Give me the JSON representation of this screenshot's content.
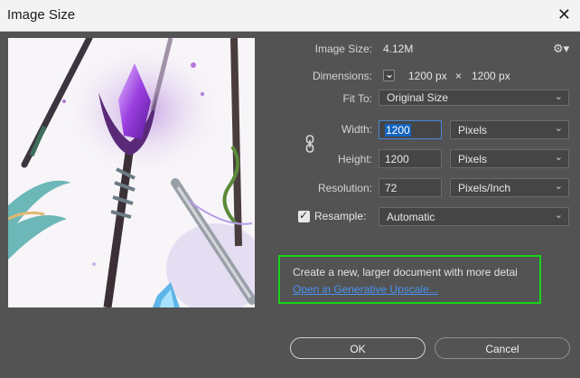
{
  "window": {
    "title": "Image Size",
    "close_icon": "close-icon"
  },
  "info": {
    "image_size_label": "Image Size:",
    "image_size_value": "4.12M",
    "dimensions_label": "Dimensions:",
    "dim_width": "1200 px",
    "dim_times": "×",
    "dim_height": "1200 px"
  },
  "fit_to": {
    "label": "Fit To:",
    "value": "Original Size"
  },
  "width": {
    "label": "Width:",
    "value": "1200",
    "unit": "Pixels"
  },
  "height": {
    "label": "Height:",
    "value": "1200",
    "unit": "Pixels"
  },
  "resolution": {
    "label": "Resolution:",
    "value": "72",
    "unit": "Pixels/Inch"
  },
  "resample": {
    "label": "Resample:",
    "checked": true,
    "value": "Automatic"
  },
  "upscale_notice": {
    "text": "Create a new, larger document with more detai",
    "link": "Open in Generative Upscale..."
  },
  "buttons": {
    "ok": "OK",
    "cancel": "Cancel"
  },
  "colors": {
    "dialog_bg": "#535353",
    "titlebar_bg": "#f3f3f3",
    "focus_blue": "#4a87d8",
    "highlight_green": "#19d419",
    "link_blue": "#4c92f0"
  }
}
